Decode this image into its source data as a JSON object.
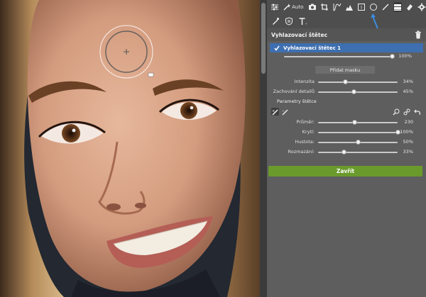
{
  "toolbar": {
    "auto_label": "Auto",
    "row1_icons": [
      "sliders-icon",
      "wand-icon",
      "camera-icon",
      "crop-icon",
      "curves-icon",
      "histogram-icon",
      "exposure-icon",
      "circle-icon",
      "brush-icon",
      "layers-icon",
      "eraser-icon",
      "settings-icon"
    ],
    "row2_icons": [
      "clone-brush-icon",
      "shield-icon",
      "text-icon"
    ]
  },
  "section": {
    "title": "Vyhlazovací štětec"
  },
  "layer": {
    "name": "Vyhlazovací štětec 1",
    "checked": true,
    "opacity_value": "100%",
    "opacity_fraction": 1.0
  },
  "add_mask_label": "Přidat masku",
  "adjustments": [
    {
      "label": "Intenzita",
      "value": "34%",
      "fraction": 0.34
    },
    {
      "label": "Zachování detailů",
      "value": "45%",
      "fraction": 0.45
    }
  ],
  "brush_params_title": "Parametry štětce",
  "brush_params": [
    {
      "label": "Průměr:",
      "value": "230",
      "fraction": 0.46
    },
    {
      "label": "Krytí:",
      "value": "100%",
      "fraction": 1.0
    },
    {
      "label": "Hustota:",
      "value": "50%",
      "fraction": 0.5
    },
    {
      "label": "Rozmazání:",
      "value": "33%",
      "fraction": 0.33
    }
  ],
  "close_label": "Zavřít",
  "colors": {
    "panel_bg": "#5e5e5e",
    "selected_layer": "#3e6fb0",
    "close_button": "#6a9a2c",
    "hint_arrow": "#3b8ee0"
  }
}
